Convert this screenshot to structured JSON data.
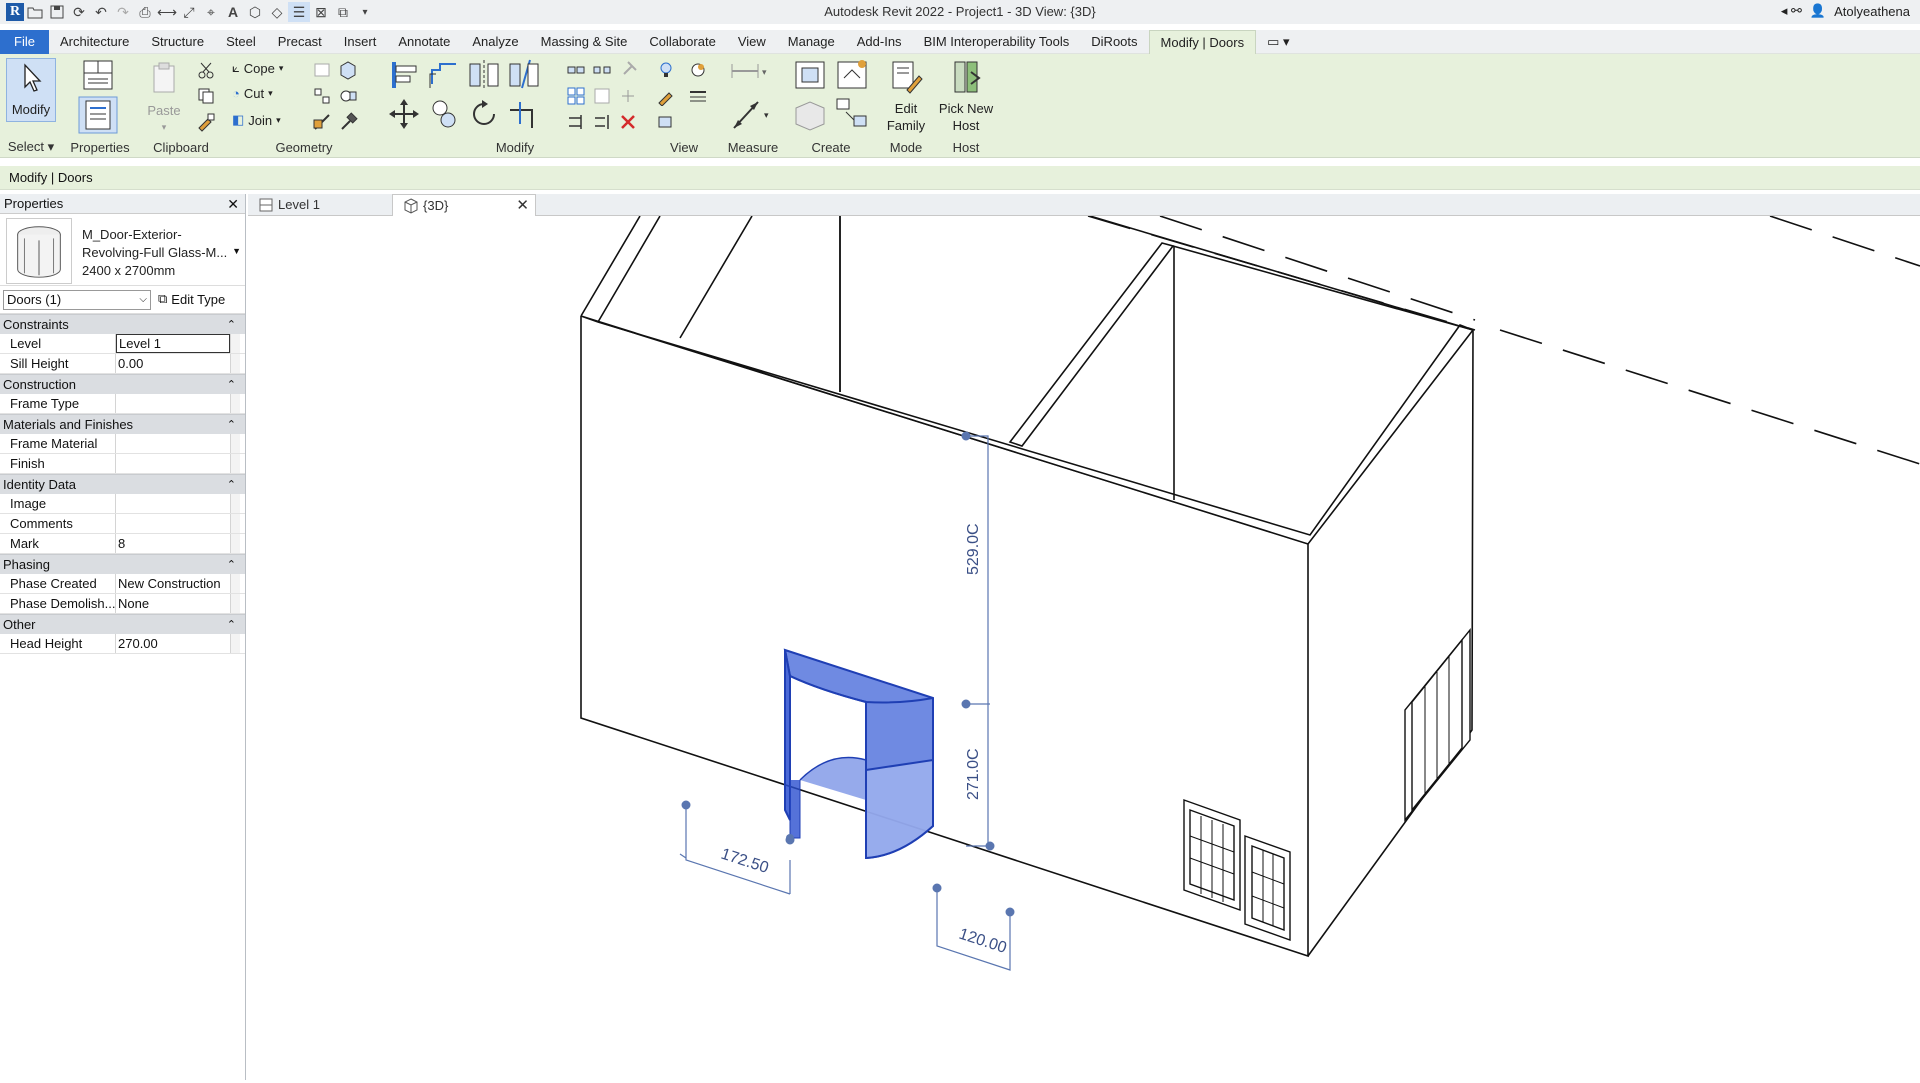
{
  "app": {
    "title": "Autodesk Revit 2022 - Project1 - 3D View: {3D}",
    "user": "Atolyeathena"
  },
  "tabs": [
    "Architecture",
    "Structure",
    "Steel",
    "Precast",
    "Insert",
    "Annotate",
    "Analyze",
    "Massing & Site",
    "Collaborate",
    "View",
    "Manage",
    "Add-Ins",
    "BIM Interoperability Tools",
    "DiRoots",
    "Modify | Doors"
  ],
  "file_tab": "File",
  "ribbon": {
    "modify_label": "Modify",
    "paste_label": "Paste",
    "cope_label": "Cope",
    "cut_label": "Cut",
    "join_label": "Join",
    "edit_family_label": "Edit Family",
    "pick_host_label": "Pick New Host",
    "panels": {
      "select": "Select",
      "properties": "Properties",
      "clipboard": "Clipboard",
      "geometry": "Geometry",
      "modify": "Modify",
      "view": "View",
      "measure": "Measure",
      "create": "Create",
      "mode": "Mode",
      "host": "Host"
    }
  },
  "options_bar": "Modify | Doors",
  "properties": {
    "title": "Properties",
    "type_name": "M_Door-Exterior-Revolving-Full Glass-M...",
    "type_size": "2400 x 2700mm",
    "filter": "Doors (1)",
    "edit_type": "Edit Type",
    "groups": [
      {
        "name": "Constraints",
        "rows": [
          {
            "k": "Level",
            "v": "Level 1"
          },
          {
            "k": "Sill Height",
            "v": "0.00"
          }
        ]
      },
      {
        "name": "Construction",
        "rows": [
          {
            "k": "Frame Type",
            "v": ""
          }
        ]
      },
      {
        "name": "Materials and Finishes",
        "rows": [
          {
            "k": "Frame Material",
            "v": ""
          },
          {
            "k": "Finish",
            "v": ""
          }
        ]
      },
      {
        "name": "Identity Data",
        "rows": [
          {
            "k": "Image",
            "v": ""
          },
          {
            "k": "Comments",
            "v": ""
          },
          {
            "k": "Mark",
            "v": "8"
          }
        ]
      },
      {
        "name": "Phasing",
        "rows": [
          {
            "k": "Phase Created",
            "v": "New Construction"
          },
          {
            "k": "Phase Demolish...",
            "v": "None"
          }
        ]
      },
      {
        "name": "Other",
        "rows": [
          {
            "k": "Head Height",
            "v": "270.00"
          }
        ]
      }
    ]
  },
  "view_tabs": [
    {
      "label": "Level 1",
      "active": false
    },
    {
      "label": "{3D}",
      "active": true
    }
  ],
  "dimensions": {
    "upper": "529.0C",
    "lower": "271.0C",
    "left": "172.50",
    "right": "120.00"
  },
  "colors": {
    "ribbon_bg": "#e7f1dc",
    "file_tab": "#2d6fce",
    "selection": "#1f4fd1"
  }
}
